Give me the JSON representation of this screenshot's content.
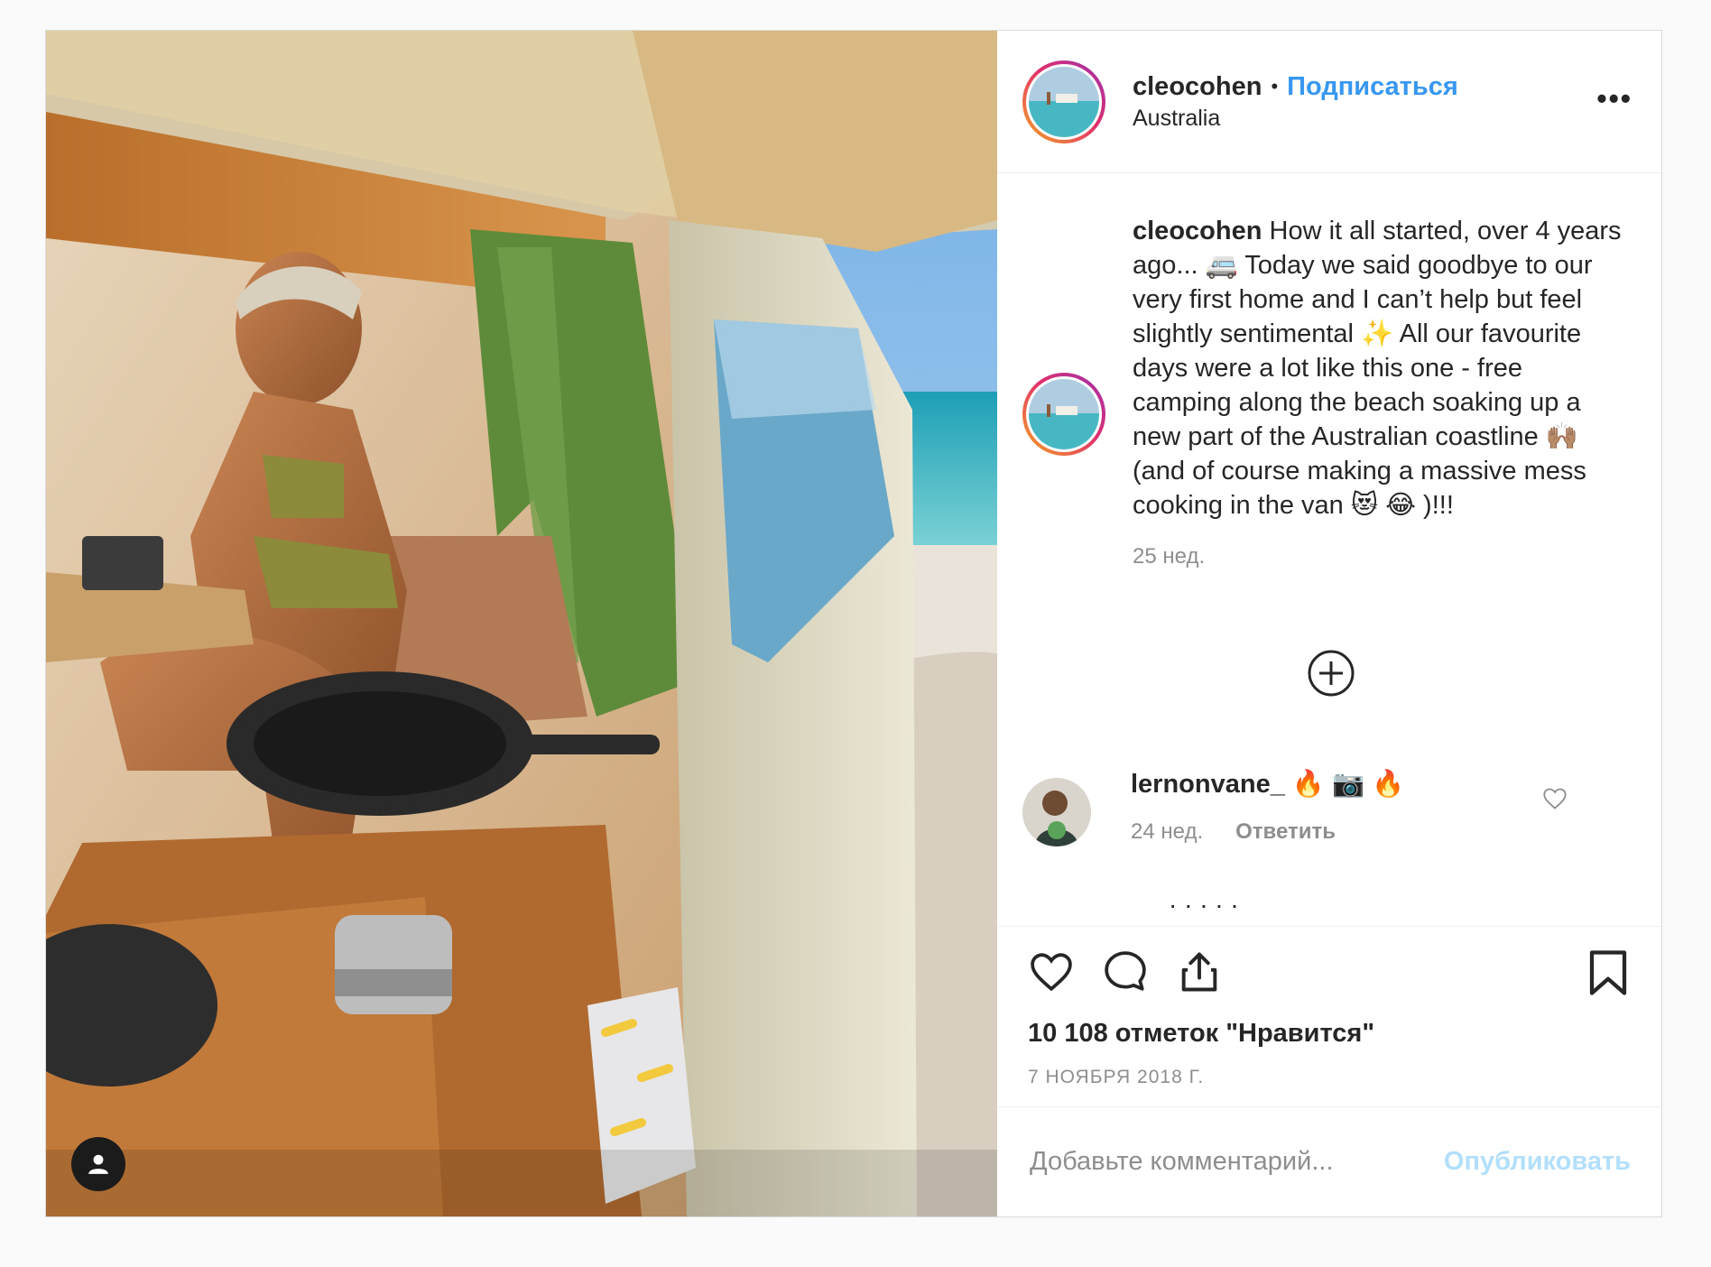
{
  "post": {
    "author": {
      "username": "cleocohen",
      "follow_label": "Подписаться",
      "location": "Australia"
    },
    "more_icon": "more-horizontal-icon",
    "caption": {
      "username": "cleocohen",
      "text": "How it all started, over 4 years ago... 🚐  Today we said goodbye to our very first home and I can’t help but feel slightly sentimental ✨  All our favourite days were a lot like this one - free camping along the beach soaking up a new part of the Australian coastline 🙌🏽 (and of course making a massive mess cooking in the van 😻 😂 )!!!",
      "time": "25 нед."
    },
    "load_more_icon": "plus-circle-icon",
    "comments": [
      {
        "username": "lernonvane_",
        "text": "🔥 📷 🔥",
        "time": "24 нед.",
        "reply_label": "Ответить"
      }
    ],
    "likes_text": "10 108 отметок \"Нравится\"",
    "date": "7 НОЯБРЯ 2018 Г.",
    "add_comment": {
      "placeholder": "Добавьте комментарий...",
      "publish_label": "Опубликовать"
    },
    "colors": {
      "link": "#3897f0",
      "muted": "#8e8e8e",
      "publish_disabled": "#b2dffc",
      "text": "#262626"
    }
  }
}
